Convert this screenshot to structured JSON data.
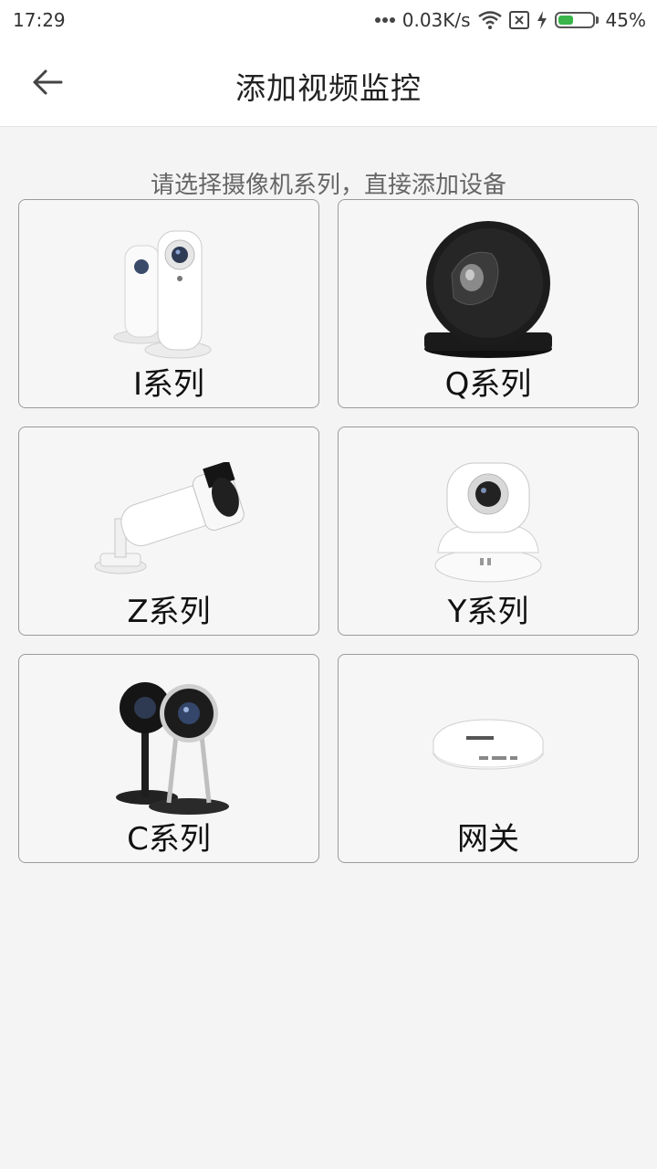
{
  "status_bar": {
    "time": "17:29",
    "network_speed": "0.03K/s",
    "battery_percent": "45%",
    "battery_level": 0.45,
    "icons": [
      "more-dots-icon",
      "wifi-icon",
      "sim-x-icon",
      "charging-bolt-icon",
      "battery-icon"
    ]
  },
  "header": {
    "title": "添加视频监控",
    "back_icon": "arrow-left-icon"
  },
  "subtitle": "请选择摄像机系列，直接添加设备",
  "series": [
    {
      "id": "i",
      "label": "I系列",
      "image": "i-series-camera"
    },
    {
      "id": "q",
      "label": "Q系列",
      "image": "q-series-camera"
    },
    {
      "id": "z",
      "label": "Z系列",
      "image": "z-series-bullet-camera"
    },
    {
      "id": "y",
      "label": "Y系列",
      "image": "y-series-pan-tilt-camera"
    },
    {
      "id": "c",
      "label": "C系列",
      "image": "c-series-camera"
    },
    {
      "id": "gateway",
      "label": "网关",
      "image": "gateway-device"
    }
  ],
  "colors": {
    "background": "#f4f4f4",
    "card_border": "#9a9a9a",
    "battery_green": "#3ab54a"
  }
}
